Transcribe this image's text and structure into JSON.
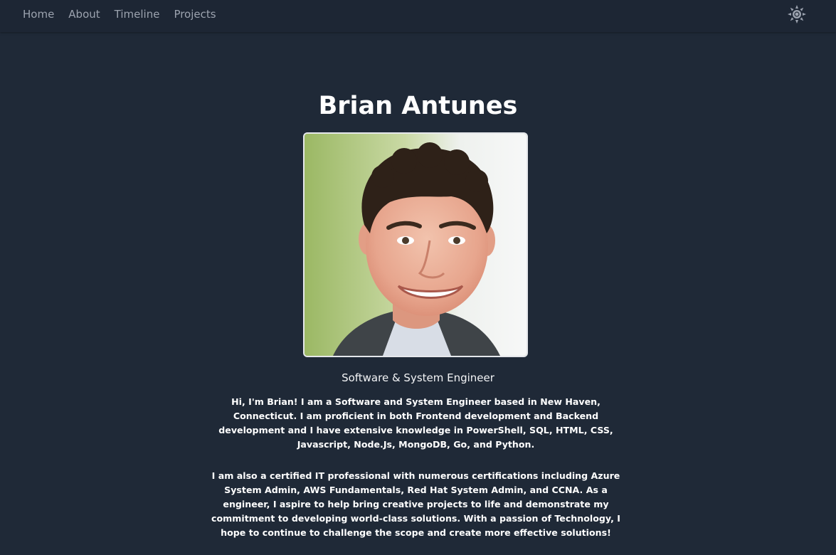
{
  "nav": {
    "items": [
      {
        "label": "Home"
      },
      {
        "label": "About"
      },
      {
        "label": "Timeline"
      },
      {
        "label": "Projects"
      }
    ],
    "theme_toggle_icon": "sun-icon"
  },
  "profile": {
    "name": "Brian Antunes",
    "photo_icon": "profile-photo",
    "role": "Software & System Engineer",
    "bio": [
      "Hi, I'm Brian! I am a Software and System Engineer based in New Haven, Connecticut. I am proficient in both Frontend development and Backend development and I have extensive knowledge in PowerShell, SQL, HTML, CSS, Javascript, Node.Js, MongoDB, Go, and Python.",
      "I am also a certified IT professional with numerous certifications including Azure System Admin, AWS Fundamentals, Red Hat System Admin, and CCNA. As a engineer, I aspire to help bring creative projects to life and demonstrate my commitment to developing world-class solutions. With a passion of Technology, I hope to continue to challenge the scope and create more effective solutions!"
    ]
  },
  "colors": {
    "background": "#1f2937",
    "navbar": "#1d2634",
    "nav_text": "#9ca3af",
    "text": "#ffffff"
  }
}
